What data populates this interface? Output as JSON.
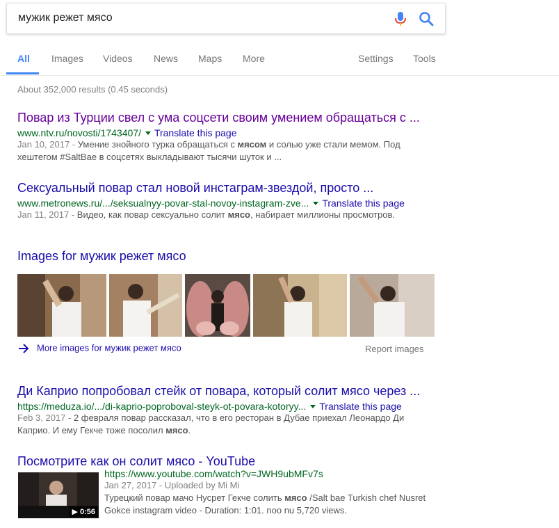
{
  "search": {
    "query": "мужик режет мясо"
  },
  "tabs": {
    "all": "All",
    "images": "Images",
    "videos": "Videos",
    "news": "News",
    "maps": "Maps",
    "more": "More",
    "settings": "Settings",
    "tools": "Tools"
  },
  "stats": "About 352,000 results (0.45 seconds)",
  "results": [
    {
      "title": "Повар из Турции свел с ума соцсети своим умением обращаться с ...",
      "url": "www.ntv.ru/novosti/1743407/",
      "translate": "Translate this page",
      "date": "Jan 10, 2017 -",
      "snippet_1a": "Умение знойного турка обращаться с ",
      "snippet_1b": "мясом",
      "snippet_1c": " и солью уже стали мемом. Под",
      "snippet_2": "хештегом #SaltBae в соцсетях выкладывают тысячи шуток и ..."
    },
    {
      "title": "Сексуальный повар стал новой инстаграм-звездой, просто ...",
      "url": "www.metronews.ru/.../seksualnyy-povar-stal-novoy-instagram-zve...",
      "translate": "Translate this page",
      "date": "Jan 11, 2017 -",
      "snippet_1a": "Видео, как повар сексуально солит ",
      "snippet_1b": "мясо",
      "snippet_1c": ", набирает миллионы просмотров."
    },
    {
      "title": "Ди Каприо попробовал стейк от повара, который солит мясо через ...",
      "url": "https://meduza.io/.../di-kaprio-poproboval-steyk-ot-povara-kotoryy...",
      "translate": "Translate this page",
      "date": "Feb 3, 2017 -",
      "snippet_1": "2 февраля повар рассказал, что в его ресторан в Дубае приехал Леонардо Ди",
      "snippet_2a": "Каприо. И ему Гекче тоже посолил ",
      "snippet_2b": "мясо",
      "snippet_2c": "."
    },
    {
      "title": "Посмотрите как он солит мясо - YouTube",
      "url": "https://www.youtube.com/watch?v=JWH9ubMFv7s",
      "meta": "Jan 27, 2017 - Uploaded by Mi Mi",
      "snippet_1a": "Турецкий повар мачо Нусрет Гекче солить ",
      "snippet_1b": "мясо",
      "snippet_1c": " /Salt bae Turkish chef Nusret",
      "snippet_2": "Gokce instagram video - Duration: 1:01. noo nu 5,720 views.",
      "duration": "▶ 0:56"
    }
  ],
  "images_block": {
    "heading": "Images for мужик режет мясо",
    "more": "More images for мужик режет мясо",
    "report": "Report images"
  },
  "colors": {
    "link": "#1a0dab",
    "visited": "#660099",
    "url": "#006621",
    "accent": "#4285f4"
  }
}
